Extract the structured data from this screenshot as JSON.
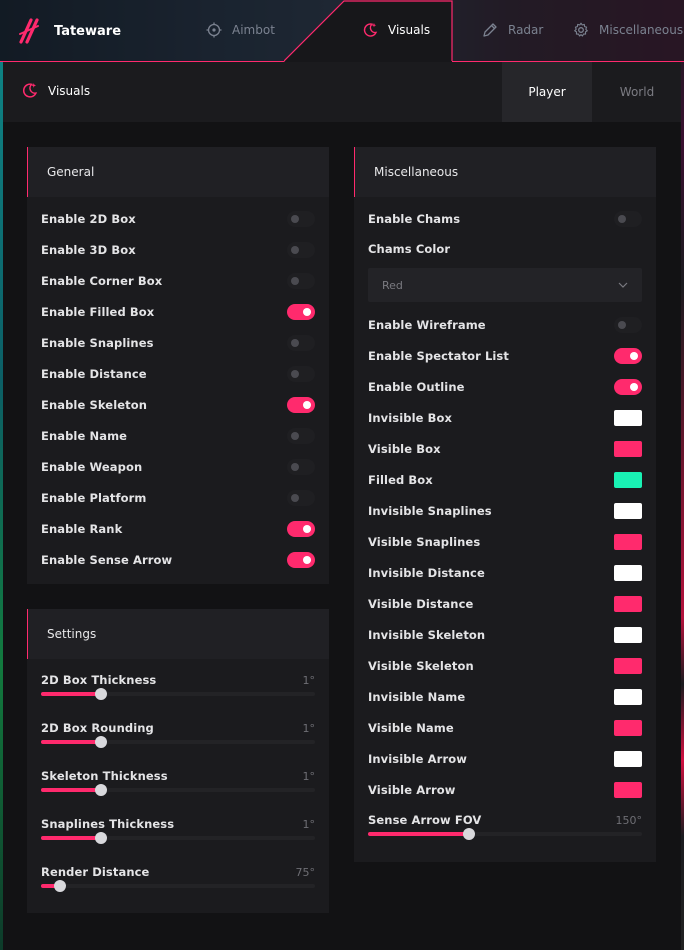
{
  "app": {
    "name": "Tateware"
  },
  "nav": {
    "items": [
      {
        "label": "Aimbot",
        "icon": "crosshair-icon"
      },
      {
        "label": "Visuals",
        "icon": "moon-star-icon"
      },
      {
        "label": "Radar",
        "icon": "pen-icon"
      },
      {
        "label": "Miscellaneous",
        "icon": "gear-icon"
      }
    ],
    "active": "Visuals"
  },
  "subheader": {
    "title": "Visuals",
    "tabs": [
      {
        "label": "Player"
      },
      {
        "label": "World"
      }
    ],
    "active_tab": "Player"
  },
  "colors": {
    "accent": "#ff2a6d",
    "white": "#ffffff",
    "teal": "#19f2b4"
  },
  "general": {
    "title": "General",
    "toggles": [
      {
        "label": "Enable 2D Box",
        "on": false
      },
      {
        "label": "Enable 3D Box",
        "on": false
      },
      {
        "label": "Enable Corner Box",
        "on": false
      },
      {
        "label": "Enable Filled Box",
        "on": true
      },
      {
        "label": "Enable Snaplines",
        "on": false
      },
      {
        "label": "Enable Distance",
        "on": false
      },
      {
        "label": "Enable Skeleton",
        "on": true
      },
      {
        "label": "Enable Name",
        "on": false
      },
      {
        "label": "Enable Weapon",
        "on": false
      },
      {
        "label": "Enable Platform",
        "on": false
      },
      {
        "label": "Enable Rank",
        "on": true
      },
      {
        "label": "Enable Sense Arrow",
        "on": true
      }
    ]
  },
  "settings": {
    "title": "Settings",
    "sliders": [
      {
        "label": "2D Box Thickness",
        "value": "1°",
        "fraction": 0.22
      },
      {
        "label": "2D Box Rounding",
        "value": "1°",
        "fraction": 0.22
      },
      {
        "label": "Skeleton Thickness",
        "value": "1°",
        "fraction": 0.22
      },
      {
        "label": "Snaplines Thickness",
        "value": "1°",
        "fraction": 0.22
      },
      {
        "label": "Render Distance",
        "value": "75°",
        "fraction": 0.07
      }
    ]
  },
  "misc": {
    "title": "Miscellaneous",
    "enable_chams": {
      "label": "Enable Chams",
      "on": false
    },
    "chams_color": {
      "label": "Chams Color",
      "value": "Red"
    },
    "toggles": [
      {
        "label": "Enable Wireframe",
        "on": false
      },
      {
        "label": "Enable Spectator List",
        "on": true
      },
      {
        "label": "Enable Outline",
        "on": true
      }
    ],
    "colors": [
      {
        "label": "Invisible Box",
        "color": "#ffffff"
      },
      {
        "label": "Visible Box",
        "color": "#ff2a6d"
      },
      {
        "label": "Filled Box",
        "color": "#19f2b4"
      },
      {
        "label": "Invisible Snaplines",
        "color": "#ffffff"
      },
      {
        "label": "Visible Snaplines",
        "color": "#ff2a6d"
      },
      {
        "label": "Invisible Distance",
        "color": "#ffffff"
      },
      {
        "label": "Visible Distance",
        "color": "#ff2a6d"
      },
      {
        "label": "Invisible Skeleton",
        "color": "#ffffff"
      },
      {
        "label": "Visible Skeleton",
        "color": "#ff2a6d"
      },
      {
        "label": "Invisible Name",
        "color": "#ffffff"
      },
      {
        "label": "Visible Name",
        "color": "#ff2a6d"
      },
      {
        "label": "Invisible Arrow",
        "color": "#ffffff"
      },
      {
        "label": "Visible Arrow",
        "color": "#ff2a6d"
      }
    ],
    "slider": {
      "label": "Sense Arrow FOV",
      "value": "150°",
      "fraction": 0.37
    }
  }
}
